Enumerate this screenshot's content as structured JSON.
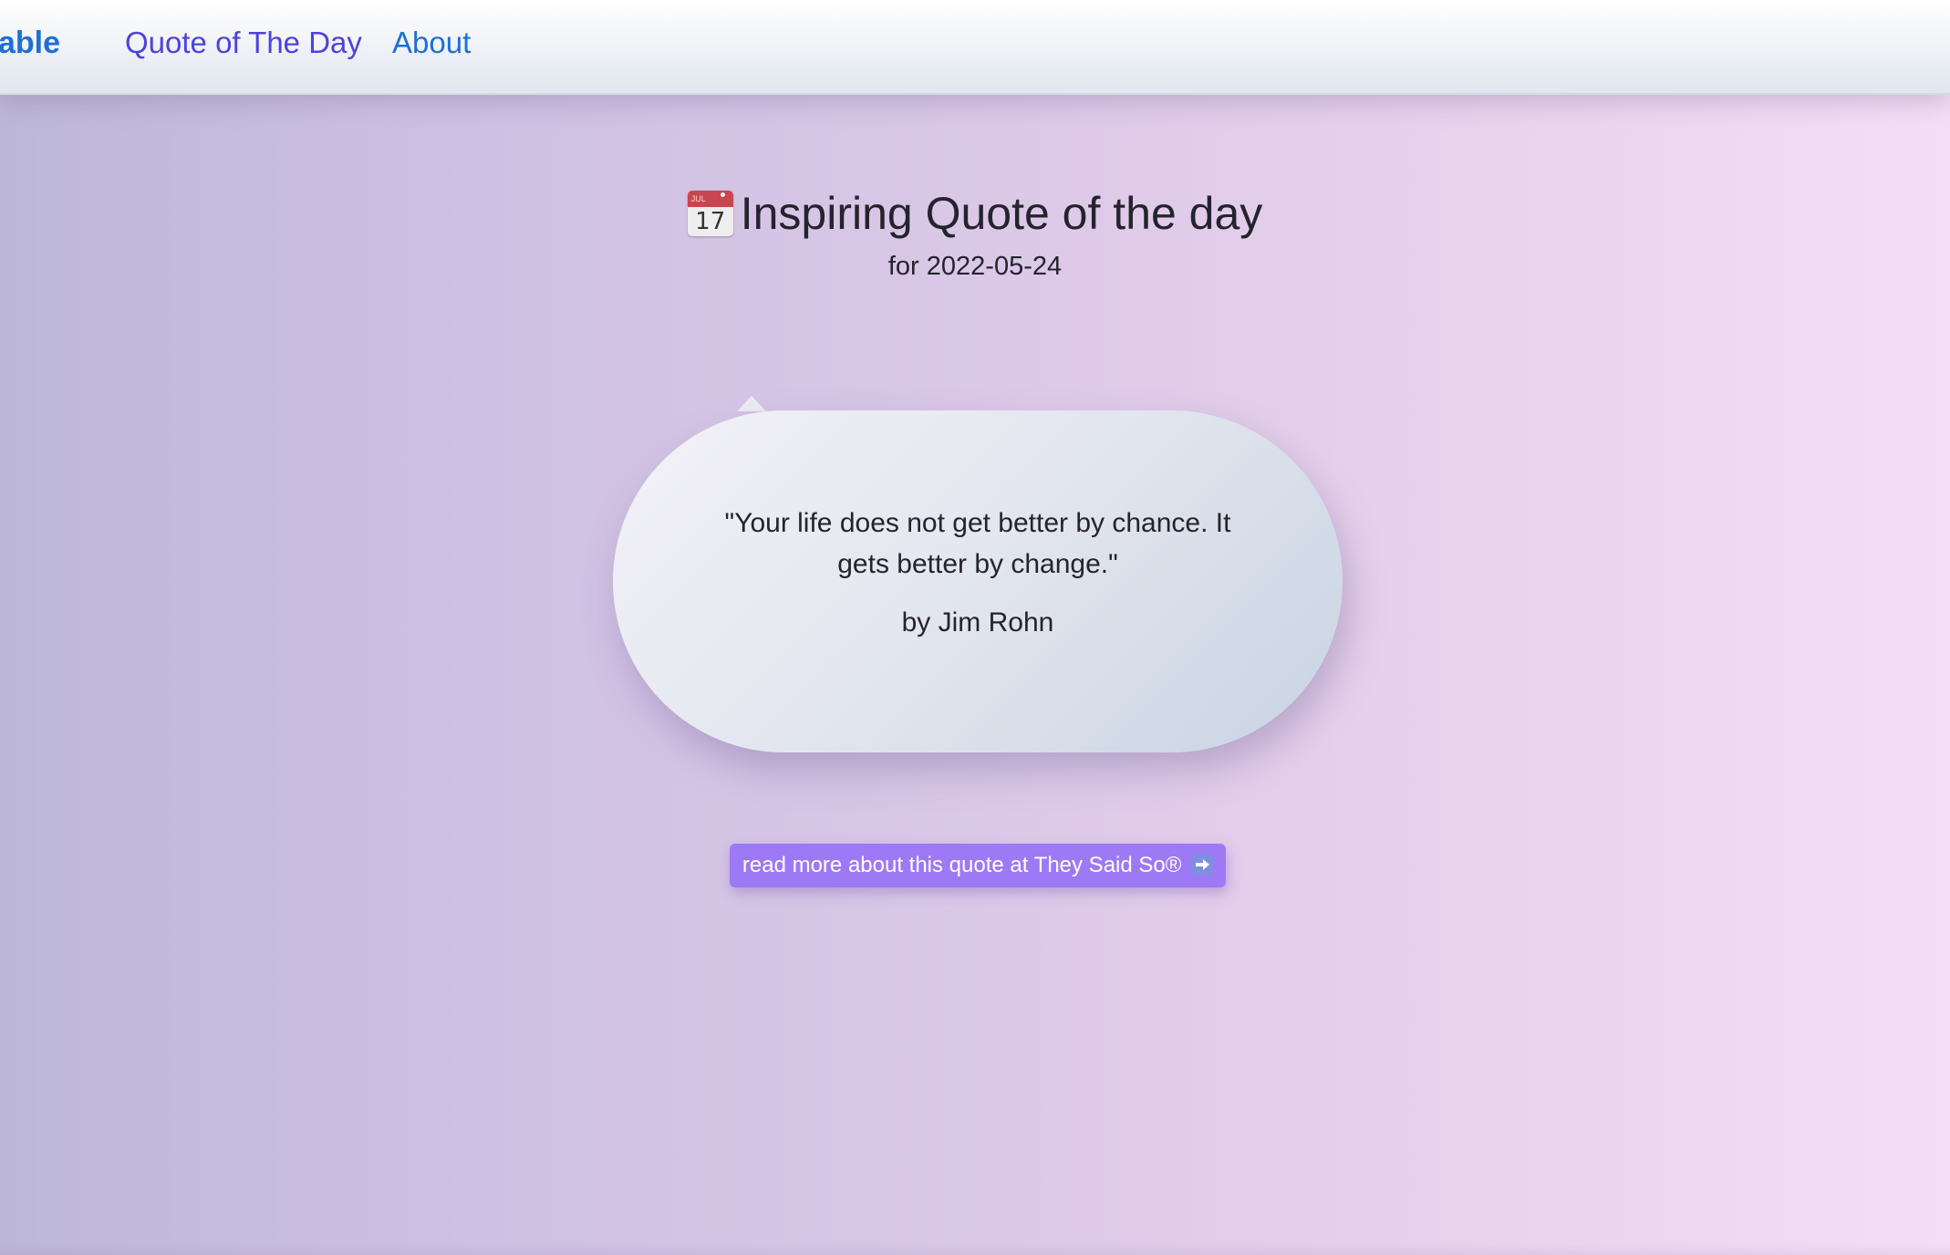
{
  "nav": {
    "brand": "able",
    "links": [
      {
        "label": "Quote of The Day"
      },
      {
        "label": "About"
      }
    ]
  },
  "header": {
    "calendar_icon": {
      "month": "JUL",
      "day": "17"
    },
    "title": "Inspiring Quote of the day",
    "subtitle": "for 2022-05-24"
  },
  "quote": {
    "text": "\"Your life does not get better by chance. It gets better by change.\"",
    "author": "by Jim Rohn"
  },
  "read_more": {
    "label": "read more about this quote at They Said So®",
    "icon": "right-arrow-icon"
  },
  "colors": {
    "brand": "#1f6fd6",
    "active_link": "#4d43dc",
    "button": "#9e79f5",
    "text": "#25232e"
  }
}
